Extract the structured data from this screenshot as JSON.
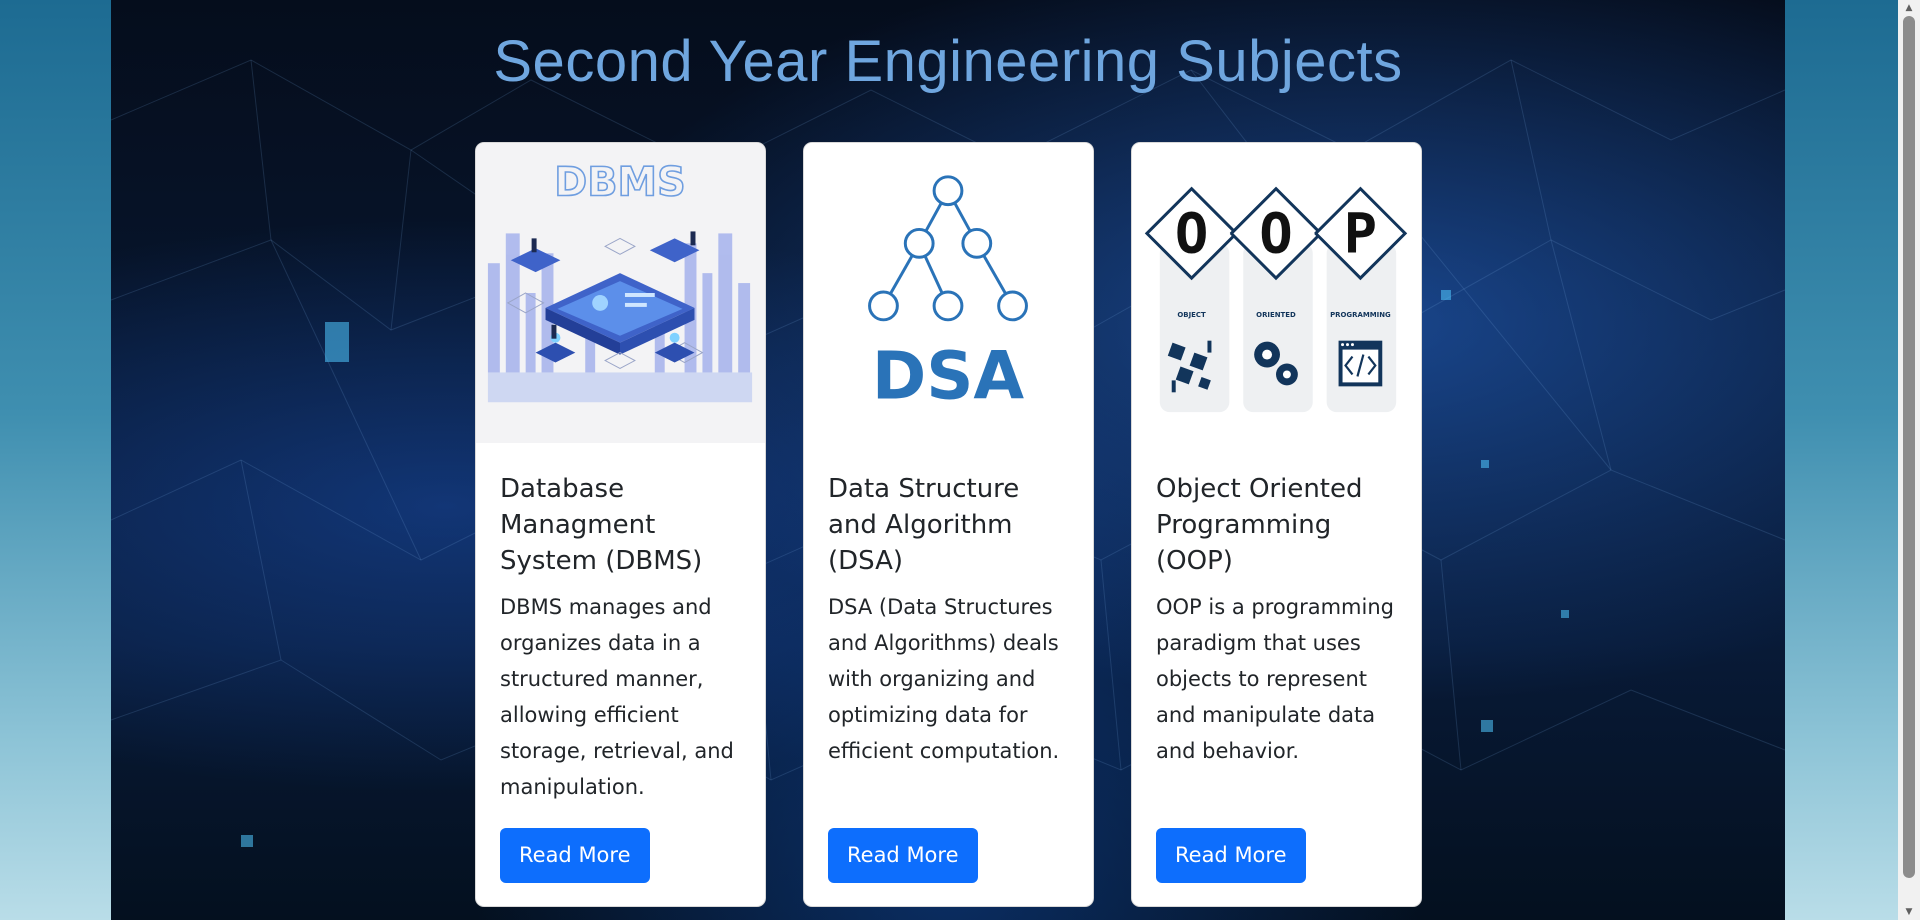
{
  "page": {
    "title": "Second Year Engineering Subjects"
  },
  "cards": [
    {
      "title": "Database Managment System (DBMS)",
      "text": "DBMS manages and organizes data in a structured manner, allowing efficient storage, retrieval, and manipulation.",
      "button": "Read More",
      "image_label": "DBMS"
    },
    {
      "title": "Data Structure and Algorithm (DSA)",
      "text": "DSA (Data Structures and Algorithms) deals with organizing and optimizing data for efficient computation.",
      "button": "Read More",
      "image_label": "DSA"
    },
    {
      "title": "Object Oriented Programming (OOP)",
      "text": "OOP is a programming paradigm that uses objects to represent and manipulate data and behavior.",
      "button": "Read More",
      "image_letters": [
        "O",
        "O",
        "P"
      ],
      "image_captions": [
        "OBJECT",
        "ORIENTED",
        "PROGRAMMING"
      ]
    }
  ],
  "scrollbar": {
    "up": "▲",
    "down": "▼"
  },
  "colors": {
    "accent": "#0d6efd",
    "title": "#6fa6df",
    "dsa": "#2a73b8",
    "oop": "#12355b"
  }
}
